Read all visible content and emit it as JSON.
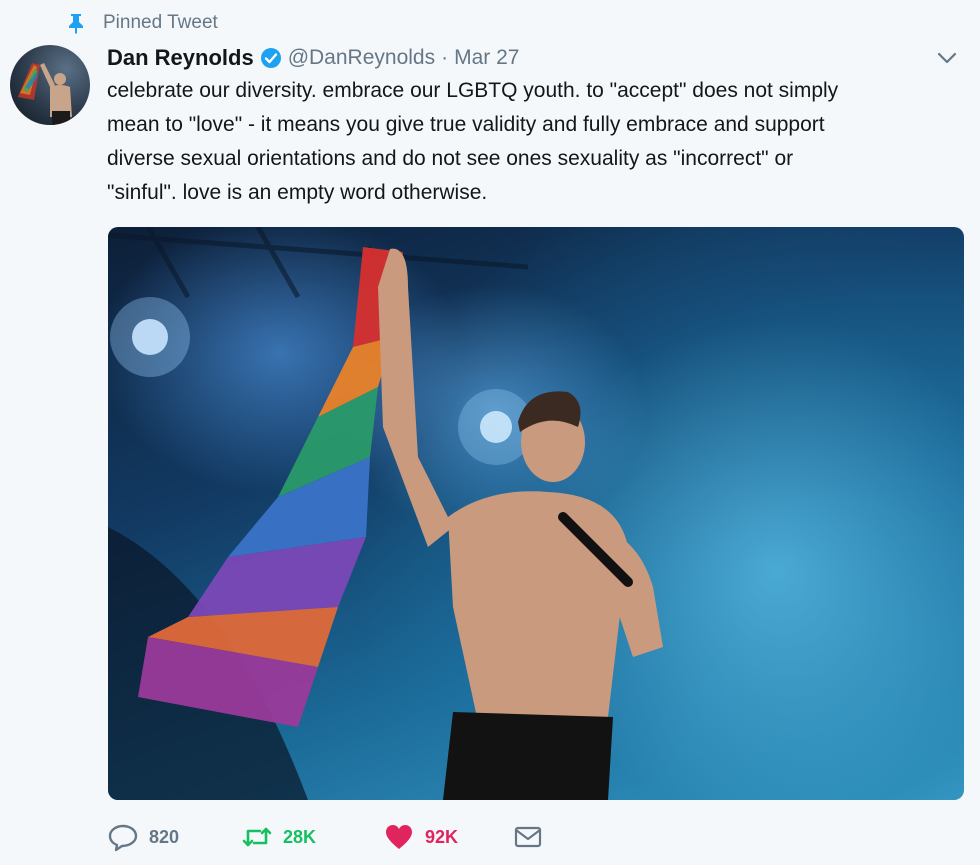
{
  "pinned": {
    "label": "Pinned Tweet",
    "icon": "pin-icon"
  },
  "tweet": {
    "author": {
      "name": "Dan Reynolds",
      "handle": "@DanReynolds",
      "verified": true,
      "avatar_icon": "avatar"
    },
    "separator": "·",
    "date": "Mar 27",
    "text": "celebrate our diversity. embrace our LGBTQ youth. to \"accept\" does not simply\nmean to \"love\" - it means you give true validity and fully embrace and support\ndiverse sexual orientations and do not see ones sexuality as \"incorrect\" or\n\"sinful\". love is an empty word otherwise.",
    "media": {
      "type": "photo"
    },
    "actions": {
      "reply_count": "820",
      "retweet_count": "28K",
      "like_count": "92K"
    }
  },
  "colors": {
    "verified": "#1da1f2",
    "retweet": "#17bf63",
    "like": "#e0245e",
    "muted": "#657786",
    "background": "#f5f8fa"
  }
}
